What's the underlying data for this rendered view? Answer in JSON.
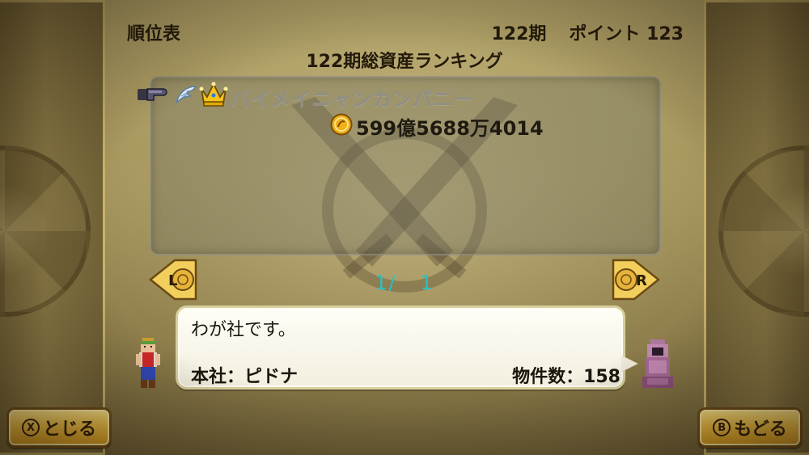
{
  "header": {
    "title": "順位表",
    "period": "122期",
    "points": "ポイント 123"
  },
  "ranking": {
    "title": "122期総資産ランキング",
    "entries": [
      {
        "company": "バイメイニャンカンパニー",
        "assets": "599億5688万4014",
        "icons": [
          "pointer-hand-icon",
          "wing-icon",
          "crown-icon",
          "gold-coin-icon"
        ]
      }
    ]
  },
  "pagination": {
    "current": "1/",
    "total": "1",
    "prev_key": "L",
    "next_key": "R"
  },
  "dialog": {
    "message": "わが社です。",
    "headquarters": "本社：ピドナ",
    "property_count": "物件数：158"
  },
  "buttons": {
    "close_key": "X",
    "close_label": "とじる",
    "back_key": "B",
    "back_label": "もどる"
  },
  "colors": {
    "page_indicator": "#29c0c8",
    "button_gold": "#f0c046",
    "company_name_gray": "#8f8f86"
  }
}
